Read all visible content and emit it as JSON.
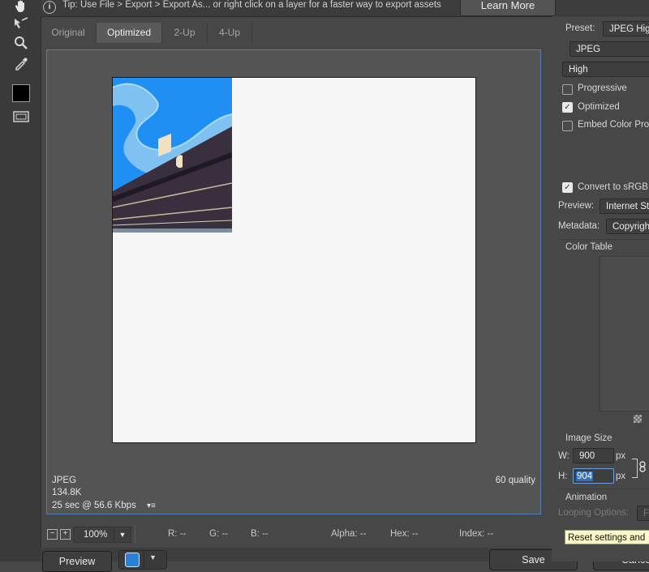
{
  "tools": {
    "items": [
      {
        "icon": "hand-icon"
      },
      {
        "icon": "slice-select-icon"
      },
      {
        "icon": "zoom-icon"
      },
      {
        "icon": "eyedropper-icon"
      },
      {
        "icon": "eyedropper-color-swatch"
      },
      {
        "icon": "toggle-slices-icon"
      }
    ],
    "swatch_color": "#000000"
  },
  "tip": {
    "text": "Tip: Use File > Export > Export As...  or right click on a layer for a faster way to export assets",
    "learn_more": "Learn More"
  },
  "tabs": [
    {
      "label": "Original",
      "active": false
    },
    {
      "label": "Optimized",
      "active": true
    },
    {
      "label": "2-Up",
      "active": false
    },
    {
      "label": "4-Up",
      "active": false
    }
  ],
  "canvas": {
    "format": "JPEG",
    "size": "134.8K",
    "download_time": "25 sec @ 56.6 Kbps",
    "quality": "60 quality"
  },
  "status": {
    "zoom": "100%",
    "r": "R: --",
    "g": "G: --",
    "b": "B: --",
    "alpha": "Alpha: --",
    "hex": "Hex: --",
    "index": "Index: --"
  },
  "bottom": {
    "preview": "Preview",
    "save": "Save",
    "cancel": "Cancel"
  },
  "settings": {
    "preset_label": "Preset:",
    "preset_value": "JPEG High",
    "format_value": "JPEG",
    "quality_value": "High",
    "progressive": {
      "label": "Progressive",
      "checked": false
    },
    "optimized": {
      "label": "Optimized",
      "checked": true
    },
    "embed": {
      "label": "Embed Color Profile",
      "checked": false
    },
    "convert": {
      "label": "Convert to sRGB",
      "checked": true
    },
    "preview_label": "Preview:",
    "preview_value": "Internet Standard RGB",
    "metadata_label": "Metadata:",
    "metadata_value": "Copyright",
    "color_table": "Color Table",
    "image_size": "Image Size",
    "w_label": "W:",
    "w_value": "900",
    "h_label": "H:",
    "h_value": "904",
    "px": "px",
    "animation": "Animation",
    "looping_label": "Looping Options:",
    "looping_value": "Forever",
    "tooltip": "Reset settings and"
  }
}
